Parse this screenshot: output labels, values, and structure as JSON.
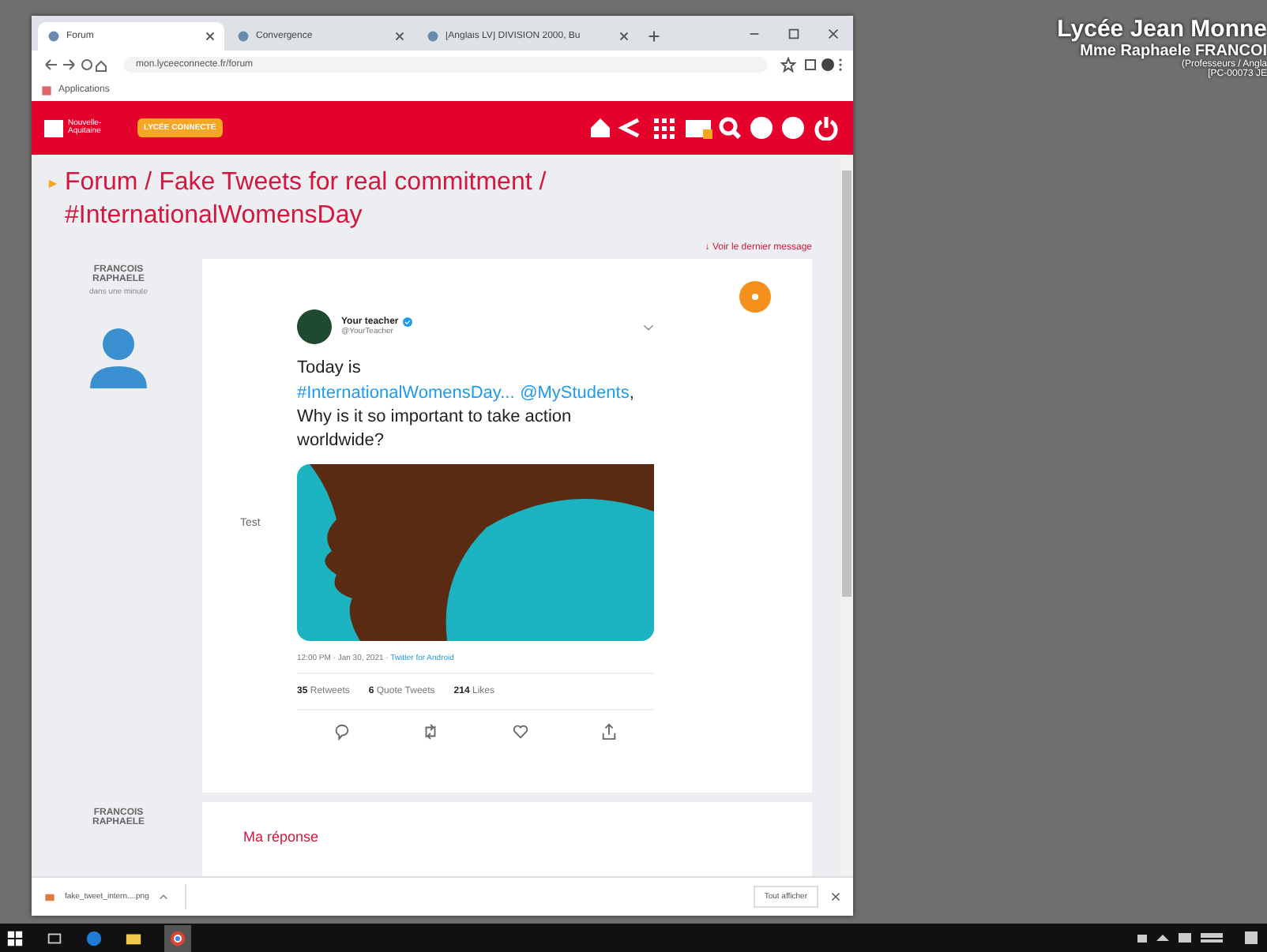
{
  "desktop": {
    "info_lines": [
      "Lycée Jean Monne",
      "Mme Raphaele FRANCOI",
      "(Professeurs / Angla",
      "[PC-00073 JE"
    ]
  },
  "browser": {
    "tabs": [
      {
        "title": "Forum",
        "selected": true
      },
      {
        "title": "Convergence",
        "selected": false
      },
      {
        "title": "[Anglais LV] DIVISION 2000, Bu",
        "selected": false
      }
    ],
    "url": "mon.lyceeconnecte.fr/forum",
    "bookmark": "Applications"
  },
  "header": {
    "region_logo": "Nouvelle-Aquitaine",
    "app_logo": "LYCÉE CONNECTÉ"
  },
  "forum": {
    "breadcrumb": "Forum / Fake Tweets for real commitment / #InternationalWomensDay",
    "last_message_link": "↓ Voir le dernier message"
  },
  "posts": [
    {
      "kind": "message",
      "author": "FRANCOIS RAPHAELE",
      "time": "dans une minute",
      "body_label": "Test"
    },
    {
      "kind": "reply",
      "author": "FRANCOIS RAPHAELE",
      "placeholder": "Ma réponse"
    }
  ],
  "tweet": {
    "name": "Your teacher",
    "handle": "@YourTeacher",
    "segments": [
      {
        "kind": "plain",
        "text": "Today is "
      },
      {
        "kind": "link",
        "text": "#InternationalWomensDay..."
      },
      {
        "kind": "link",
        "text": "@MyStudents"
      },
      {
        "kind": "plain",
        "text": ", Why is it so important to take action worldwide?"
      }
    ],
    "meta": "12:00 PM · Jan 30, 2021 · ",
    "source": "Twitter for Android",
    "stats": [
      {
        "count": "35",
        "label": "Retweets"
      },
      {
        "count": "6",
        "label": "Quote Tweets"
      },
      {
        "count": "214",
        "label": "Likes"
      }
    ]
  },
  "download_bar": {
    "file": "fake_tweet_intern....png",
    "show_all": "Tout afficher"
  }
}
